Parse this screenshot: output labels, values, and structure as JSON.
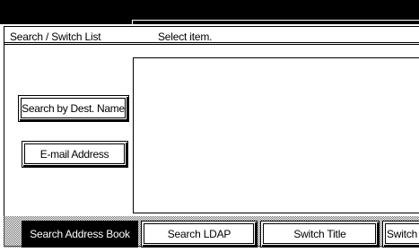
{
  "header": {
    "title": "Search / Switch List",
    "prompt": "Select item."
  },
  "buttons": {
    "search_by_dest_name": "Search by Dest. Name",
    "email_address": "E-mail Address"
  },
  "tabs": [
    {
      "label": "Search Address Book",
      "active": true
    },
    {
      "label": "Search LDAP",
      "active": false
    },
    {
      "label": "Switch Title",
      "active": false
    },
    {
      "label": "Switch",
      "active": false
    }
  ],
  "colors": {
    "foreground": "#000000",
    "background": "#ffffff",
    "active_tab_bg": "#000000",
    "active_tab_fg": "#ffffff"
  }
}
